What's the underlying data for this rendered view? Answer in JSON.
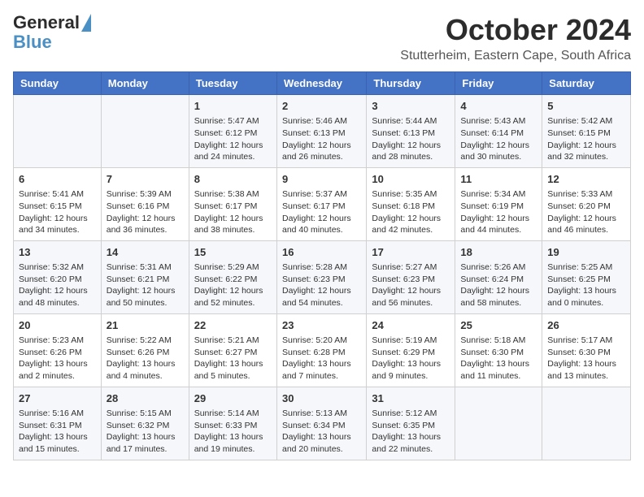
{
  "header": {
    "logo_general": "General",
    "logo_blue": "Blue",
    "month_title": "October 2024",
    "location": "Stutterheim, Eastern Cape, South Africa"
  },
  "days_of_week": [
    "Sunday",
    "Monday",
    "Tuesday",
    "Wednesday",
    "Thursday",
    "Friday",
    "Saturday"
  ],
  "weeks": [
    [
      {
        "day": "",
        "info": ""
      },
      {
        "day": "",
        "info": ""
      },
      {
        "day": "1",
        "info": "Sunrise: 5:47 AM\nSunset: 6:12 PM\nDaylight: 12 hours and 24 minutes."
      },
      {
        "day": "2",
        "info": "Sunrise: 5:46 AM\nSunset: 6:13 PM\nDaylight: 12 hours and 26 minutes."
      },
      {
        "day": "3",
        "info": "Sunrise: 5:44 AM\nSunset: 6:13 PM\nDaylight: 12 hours and 28 minutes."
      },
      {
        "day": "4",
        "info": "Sunrise: 5:43 AM\nSunset: 6:14 PM\nDaylight: 12 hours and 30 minutes."
      },
      {
        "day": "5",
        "info": "Sunrise: 5:42 AM\nSunset: 6:15 PM\nDaylight: 12 hours and 32 minutes."
      }
    ],
    [
      {
        "day": "6",
        "info": "Sunrise: 5:41 AM\nSunset: 6:15 PM\nDaylight: 12 hours and 34 minutes."
      },
      {
        "day": "7",
        "info": "Sunrise: 5:39 AM\nSunset: 6:16 PM\nDaylight: 12 hours and 36 minutes."
      },
      {
        "day": "8",
        "info": "Sunrise: 5:38 AM\nSunset: 6:17 PM\nDaylight: 12 hours and 38 minutes."
      },
      {
        "day": "9",
        "info": "Sunrise: 5:37 AM\nSunset: 6:17 PM\nDaylight: 12 hours and 40 minutes."
      },
      {
        "day": "10",
        "info": "Sunrise: 5:35 AM\nSunset: 6:18 PM\nDaylight: 12 hours and 42 minutes."
      },
      {
        "day": "11",
        "info": "Sunrise: 5:34 AM\nSunset: 6:19 PM\nDaylight: 12 hours and 44 minutes."
      },
      {
        "day": "12",
        "info": "Sunrise: 5:33 AM\nSunset: 6:20 PM\nDaylight: 12 hours and 46 minutes."
      }
    ],
    [
      {
        "day": "13",
        "info": "Sunrise: 5:32 AM\nSunset: 6:20 PM\nDaylight: 12 hours and 48 minutes."
      },
      {
        "day": "14",
        "info": "Sunrise: 5:31 AM\nSunset: 6:21 PM\nDaylight: 12 hours and 50 minutes."
      },
      {
        "day": "15",
        "info": "Sunrise: 5:29 AM\nSunset: 6:22 PM\nDaylight: 12 hours and 52 minutes."
      },
      {
        "day": "16",
        "info": "Sunrise: 5:28 AM\nSunset: 6:23 PM\nDaylight: 12 hours and 54 minutes."
      },
      {
        "day": "17",
        "info": "Sunrise: 5:27 AM\nSunset: 6:23 PM\nDaylight: 12 hours and 56 minutes."
      },
      {
        "day": "18",
        "info": "Sunrise: 5:26 AM\nSunset: 6:24 PM\nDaylight: 12 hours and 58 minutes."
      },
      {
        "day": "19",
        "info": "Sunrise: 5:25 AM\nSunset: 6:25 PM\nDaylight: 13 hours and 0 minutes."
      }
    ],
    [
      {
        "day": "20",
        "info": "Sunrise: 5:23 AM\nSunset: 6:26 PM\nDaylight: 13 hours and 2 minutes."
      },
      {
        "day": "21",
        "info": "Sunrise: 5:22 AM\nSunset: 6:26 PM\nDaylight: 13 hours and 4 minutes."
      },
      {
        "day": "22",
        "info": "Sunrise: 5:21 AM\nSunset: 6:27 PM\nDaylight: 13 hours and 5 minutes."
      },
      {
        "day": "23",
        "info": "Sunrise: 5:20 AM\nSunset: 6:28 PM\nDaylight: 13 hours and 7 minutes."
      },
      {
        "day": "24",
        "info": "Sunrise: 5:19 AM\nSunset: 6:29 PM\nDaylight: 13 hours and 9 minutes."
      },
      {
        "day": "25",
        "info": "Sunrise: 5:18 AM\nSunset: 6:30 PM\nDaylight: 13 hours and 11 minutes."
      },
      {
        "day": "26",
        "info": "Sunrise: 5:17 AM\nSunset: 6:30 PM\nDaylight: 13 hours and 13 minutes."
      }
    ],
    [
      {
        "day": "27",
        "info": "Sunrise: 5:16 AM\nSunset: 6:31 PM\nDaylight: 13 hours and 15 minutes."
      },
      {
        "day": "28",
        "info": "Sunrise: 5:15 AM\nSunset: 6:32 PM\nDaylight: 13 hours and 17 minutes."
      },
      {
        "day": "29",
        "info": "Sunrise: 5:14 AM\nSunset: 6:33 PM\nDaylight: 13 hours and 19 minutes."
      },
      {
        "day": "30",
        "info": "Sunrise: 5:13 AM\nSunset: 6:34 PM\nDaylight: 13 hours and 20 minutes."
      },
      {
        "day": "31",
        "info": "Sunrise: 5:12 AM\nSunset: 6:35 PM\nDaylight: 13 hours and 22 minutes."
      },
      {
        "day": "",
        "info": ""
      },
      {
        "day": "",
        "info": ""
      }
    ]
  ]
}
